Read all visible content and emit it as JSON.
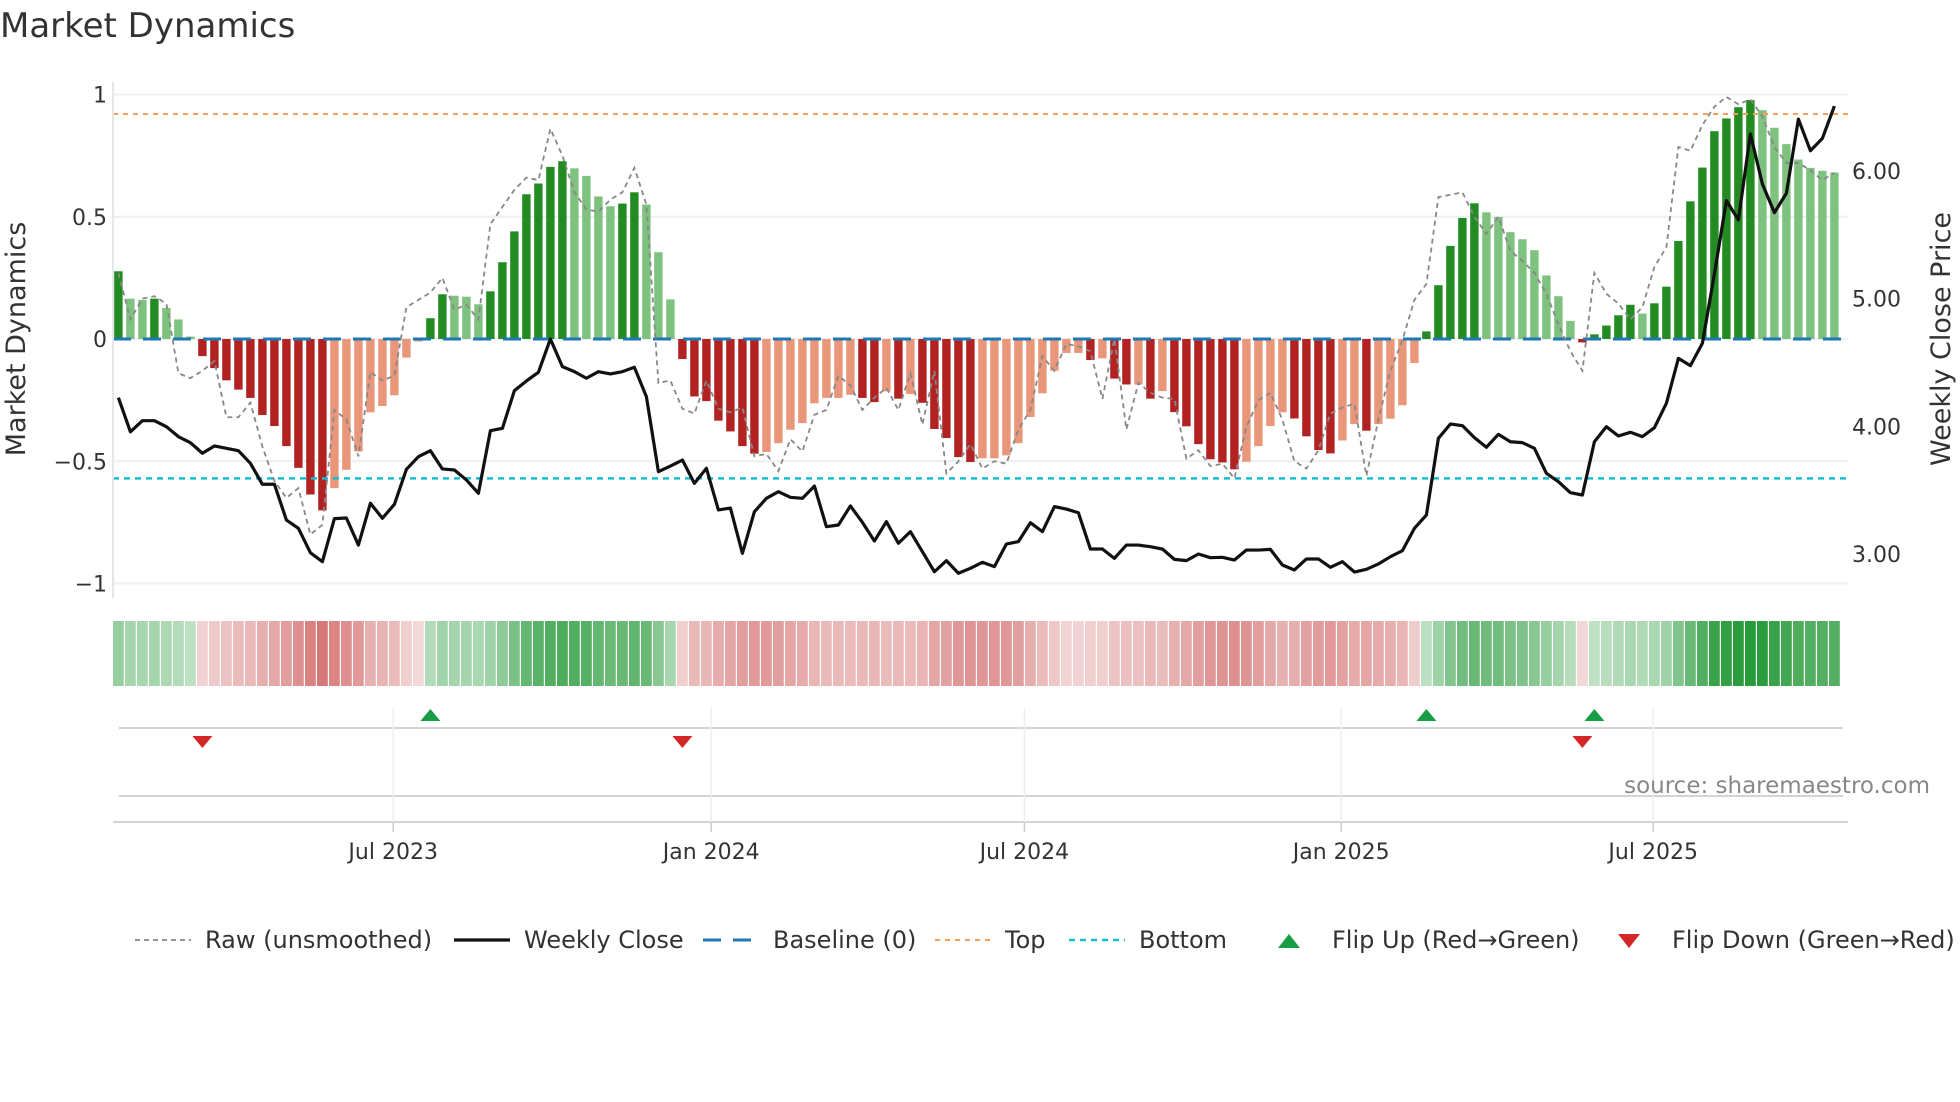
{
  "title": "Market Dynamics",
  "source_note": "source: sharemaestro.com",
  "legend": [
    {
      "label": "Raw (unsmoothed)",
      "kind": "raw"
    },
    {
      "label": "Weekly Close",
      "kind": "close"
    },
    {
      "label": "Baseline (0)",
      "kind": "baseline"
    },
    {
      "label": "Top",
      "kind": "top"
    },
    {
      "label": "Bottom",
      "kind": "bottom"
    },
    {
      "label": "Flip Up (Red→Green)",
      "kind": "flipup"
    },
    {
      "label": "Flip Down (Green→Red)",
      "kind": "flipdown"
    }
  ],
  "colors": {
    "strong_green": "#228b22",
    "weak_green": "#7fc17f",
    "strong_red": "#b22222",
    "weak_red": "#e9967a",
    "close": "#111111",
    "raw": "#888888",
    "baseline": "#1f77b4",
    "top": "#f4a15d",
    "bottom": "#17becf",
    "flip_up": "#1a9e45",
    "flip_down": "#d62728",
    "grid": "#eceff4"
  },
  "chart_data": {
    "type": "bar",
    "title": "Market Dynamics",
    "ylabel": "Market Dynamics",
    "ylabel_right": "Weekly Close Price",
    "ylim": [
      -1,
      1
    ],
    "yticks": [
      {
        "v": 1,
        "label": "1"
      },
      {
        "v": 0.5,
        "label": "0.5"
      },
      {
        "v": 0,
        "label": "0"
      },
      {
        "v": -0.5,
        "label": "−0.5"
      },
      {
        "v": -1,
        "label": "−1"
      }
    ],
    "yticks_right": [
      {
        "v": 6,
        "label": "6.00"
      },
      {
        "v": 5,
        "label": "5.00"
      },
      {
        "v": 4,
        "label": "4.00"
      },
      {
        "v": 3,
        "label": "3.00"
      }
    ],
    "xticks": [
      {
        "bar": 22.9,
        "label": "Jul 2023"
      },
      {
        "bar": 49.4,
        "label": "Jan 2024"
      },
      {
        "bar": 75.5,
        "label": "Jul 2024"
      },
      {
        "bar": 101.9,
        "label": "Jan 2025"
      },
      {
        "bar": 127.9,
        "label": "Jul 2025"
      }
    ],
    "top_level": 0.92,
    "bottom_level": -0.57,
    "baseline": 0,
    "values": [
      0.277,
      0.165,
      0.16,
      0.165,
      0.127,
      0.08,
      0.01,
      -0.07,
      -0.119,
      -0.169,
      -0.207,
      -0.241,
      -0.311,
      -0.356,
      -0.438,
      -0.527,
      -0.636,
      -0.701,
      -0.61,
      -0.535,
      -0.46,
      -0.3,
      -0.274,
      -0.23,
      -0.076,
      -0.01,
      0.085,
      0.183,
      0.177,
      0.173,
      0.142,
      0.195,
      0.314,
      0.44,
      0.592,
      0.636,
      0.704,
      0.727,
      0.698,
      0.667,
      0.583,
      0.543,
      0.554,
      0.6,
      0.55,
      0.355,
      0.162,
      -0.082,
      -0.235,
      -0.254,
      -0.334,
      -0.378,
      -0.438,
      -0.469,
      -0.462,
      -0.426,
      -0.371,
      -0.344,
      -0.263,
      -0.241,
      -0.241,
      -0.228,
      -0.241,
      -0.258,
      -0.214,
      -0.244,
      -0.225,
      -0.261,
      -0.368,
      -0.405,
      -0.483,
      -0.503,
      -0.488,
      -0.488,
      -0.476,
      -0.426,
      -0.319,
      -0.222,
      -0.13,
      -0.057,
      -0.057,
      -0.086,
      -0.079,
      -0.162,
      -0.186,
      -0.186,
      -0.244,
      -0.213,
      -0.299,
      -0.357,
      -0.43,
      -0.492,
      -0.505,
      -0.533,
      -0.502,
      -0.438,
      -0.356,
      -0.3,
      -0.325,
      -0.398,
      -0.454,
      -0.468,
      -0.415,
      -0.348,
      -0.375,
      -0.348,
      -0.326,
      -0.271,
      -0.098,
      0.031,
      0.22,
      0.381,
      0.495,
      0.555,
      0.518,
      0.499,
      0.437,
      0.408,
      0.363,
      0.26,
      0.175,
      0.074,
      -0.014,
      0.019,
      0.055,
      0.097,
      0.14,
      0.104,
      0.146,
      0.214,
      0.401,
      0.563,
      0.701,
      0.85,
      0.902,
      0.948,
      0.977,
      0.936,
      0.864,
      0.797,
      0.734,
      0.7,
      0.688,
      0.681
    ],
    "raw": [
      0.27,
      0.08,
      0.165,
      0.175,
      0.145,
      -0.14,
      -0.16,
      -0.13,
      -0.09,
      -0.32,
      -0.32,
      -0.26,
      -0.44,
      -0.58,
      -0.65,
      -0.61,
      -0.8,
      -0.76,
      -0.29,
      -0.33,
      -0.48,
      -0.135,
      -0.17,
      -0.15,
      0.13,
      0.16,
      0.19,
      0.25,
      0.12,
      0.14,
      0.08,
      0.47,
      0.54,
      0.61,
      0.66,
      0.65,
      0.86,
      0.75,
      0.6,
      0.53,
      0.52,
      0.57,
      0.6,
      0.7,
      0.55,
      -0.18,
      -0.17,
      -0.285,
      -0.305,
      -0.17,
      -0.285,
      -0.3,
      -0.28,
      -0.48,
      -0.47,
      -0.54,
      -0.41,
      -0.46,
      -0.31,
      -0.29,
      -0.15,
      -0.19,
      -0.29,
      -0.24,
      -0.2,
      -0.29,
      -0.14,
      -0.35,
      -0.13,
      -0.55,
      -0.5,
      -0.43,
      -0.53,
      -0.5,
      -0.51,
      -0.37,
      -0.29,
      -0.07,
      -0.13,
      -0.02,
      -0.03,
      -0.05,
      -0.245,
      0.0,
      -0.37,
      -0.18,
      -0.22,
      -0.24,
      -0.245,
      -0.49,
      -0.455,
      -0.52,
      -0.51,
      -0.57,
      -0.36,
      -0.25,
      -0.22,
      -0.33,
      -0.5,
      -0.53,
      -0.455,
      -0.305,
      -0.28,
      -0.265,
      -0.56,
      -0.33,
      -0.13,
      -0.005,
      0.16,
      0.225,
      0.58,
      0.59,
      0.6,
      0.5,
      0.43,
      0.5,
      0.36,
      0.32,
      0.27,
      0.185,
      0.06,
      -0.05,
      -0.13,
      0.27,
      0.185,
      0.145,
      0.08,
      0.13,
      0.295,
      0.375,
      0.785,
      0.77,
      0.875,
      0.95,
      0.99,
      0.96,
      0.98,
      0.91,
      0.785,
      0.72,
      0.72,
      0.69,
      0.65,
      0.68
    ],
    "close": [
      4.224,
      3.957,
      4.044,
      4.044,
      3.997,
      3.919,
      3.872,
      3.789,
      3.846,
      3.828,
      3.809,
      3.71,
      3.546,
      3.546,
      3.266,
      3.201,
      3.01,
      2.94,
      3.277,
      3.282,
      3.07,
      3.397,
      3.28,
      3.389,
      3.663,
      3.762,
      3.809,
      3.666,
      3.658,
      3.58,
      3.475,
      3.966,
      3.984,
      4.279,
      4.355,
      4.423,
      4.684,
      4.467,
      4.428,
      4.376,
      4.428,
      4.41,
      4.428,
      4.462,
      4.232,
      3.645,
      3.689,
      3.736,
      3.553,
      3.671,
      3.345,
      3.36,
      3.005,
      3.331,
      3.436,
      3.488,
      3.444,
      3.436,
      3.532,
      3.214,
      3.227,
      3.376,
      3.248,
      3.102,
      3.253,
      3.084,
      3.175,
      3.018,
      2.861,
      2.948,
      2.849,
      2.888,
      2.935,
      2.901,
      3.078,
      3.097,
      3.245,
      3.175,
      3.371,
      3.352,
      3.323,
      3.039,
      3.039,
      2.966,
      3.07,
      3.07,
      3.057,
      3.039,
      2.958,
      2.948,
      3.0,
      2.971,
      2.974,
      2.953,
      3.031,
      3.031,
      3.036,
      2.914,
      2.875,
      2.961,
      2.961,
      2.896,
      2.94,
      2.859,
      2.88,
      2.922,
      2.979,
      3.026,
      3.201,
      3.305,
      3.906,
      4.018,
      4.005,
      3.911,
      3.836,
      3.937,
      3.879,
      3.872,
      3.828,
      3.632,
      3.566,
      3.48,
      3.462,
      3.879,
      3.997,
      3.924,
      3.953,
      3.919,
      3.989,
      4.18,
      4.532,
      4.475,
      4.65,
      5.193,
      5.767,
      5.616,
      6.289,
      5.897,
      5.673,
      5.825,
      6.406,
      6.158,
      6.255,
      6.508
    ],
    "flips": [
      {
        "bar": 8,
        "dir": "down"
      },
      {
        "bar": 27,
        "dir": "up"
      },
      {
        "bar": 48,
        "dir": "down"
      },
      {
        "bar": 110,
        "dir": "up"
      },
      {
        "bar": 123,
        "dir": "down"
      },
      {
        "bar": 124,
        "dir": "up"
      }
    ]
  }
}
